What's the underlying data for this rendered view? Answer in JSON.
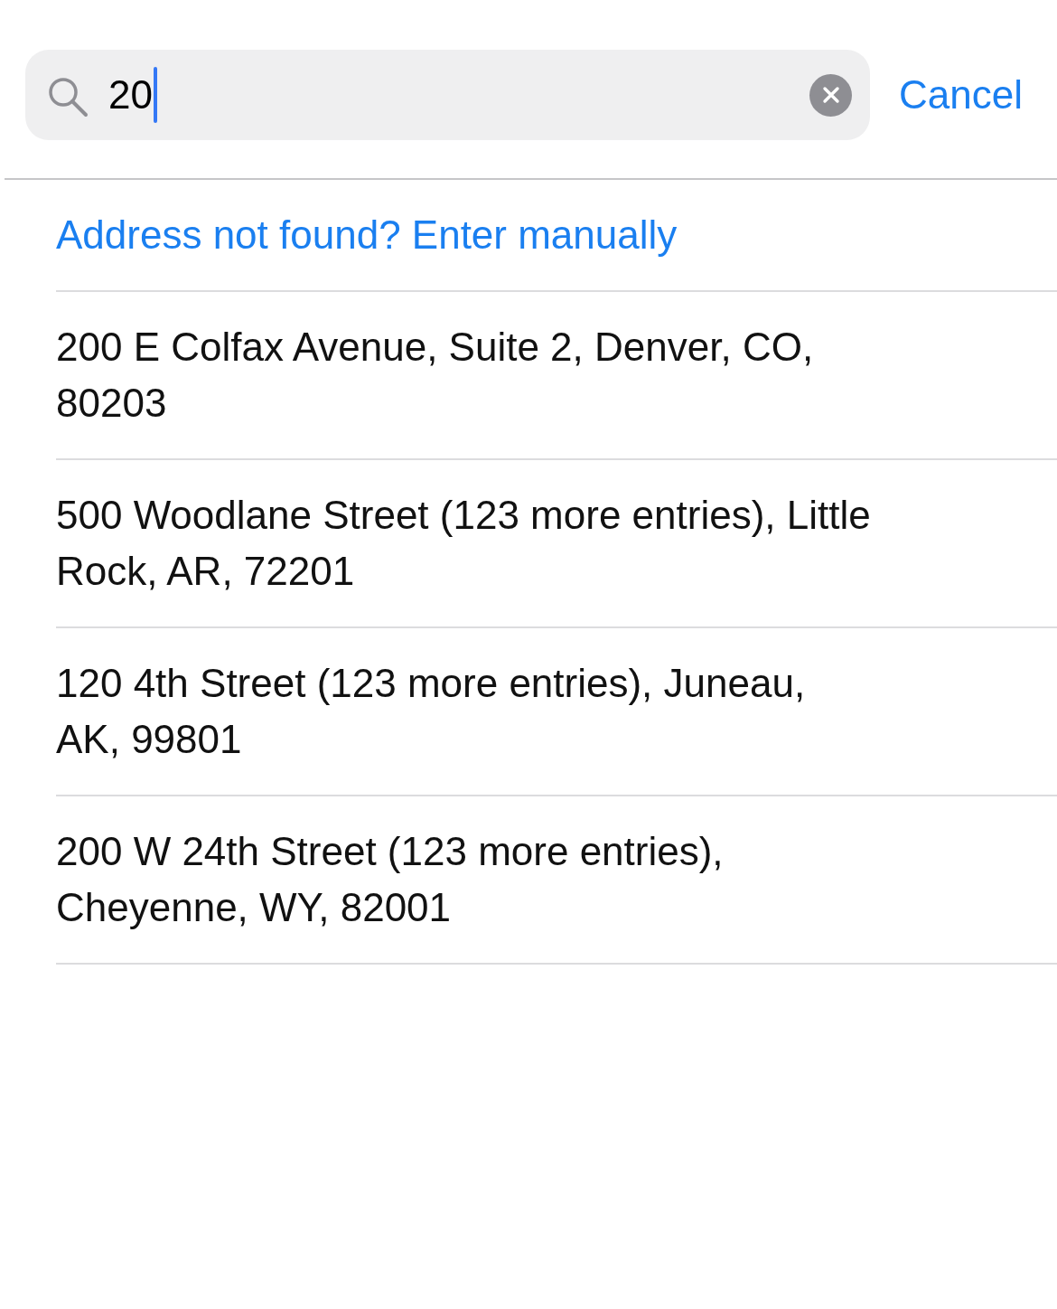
{
  "search": {
    "value": "20"
  },
  "cancel": "Cancel",
  "manual_entry_link": "Address not found? Enter manually",
  "results": [
    "200 E Colfax Avenue, Suite 2, Denver, CO, 80203",
    "500 Woodlane Street (123 more entries), Little Rock, AR, 72201",
    "120 4th Street (123 more entries), Juneau, AK, 99801",
    "200 W 24th Street (123 more entries), Cheyenne, WY, 82001"
  ]
}
